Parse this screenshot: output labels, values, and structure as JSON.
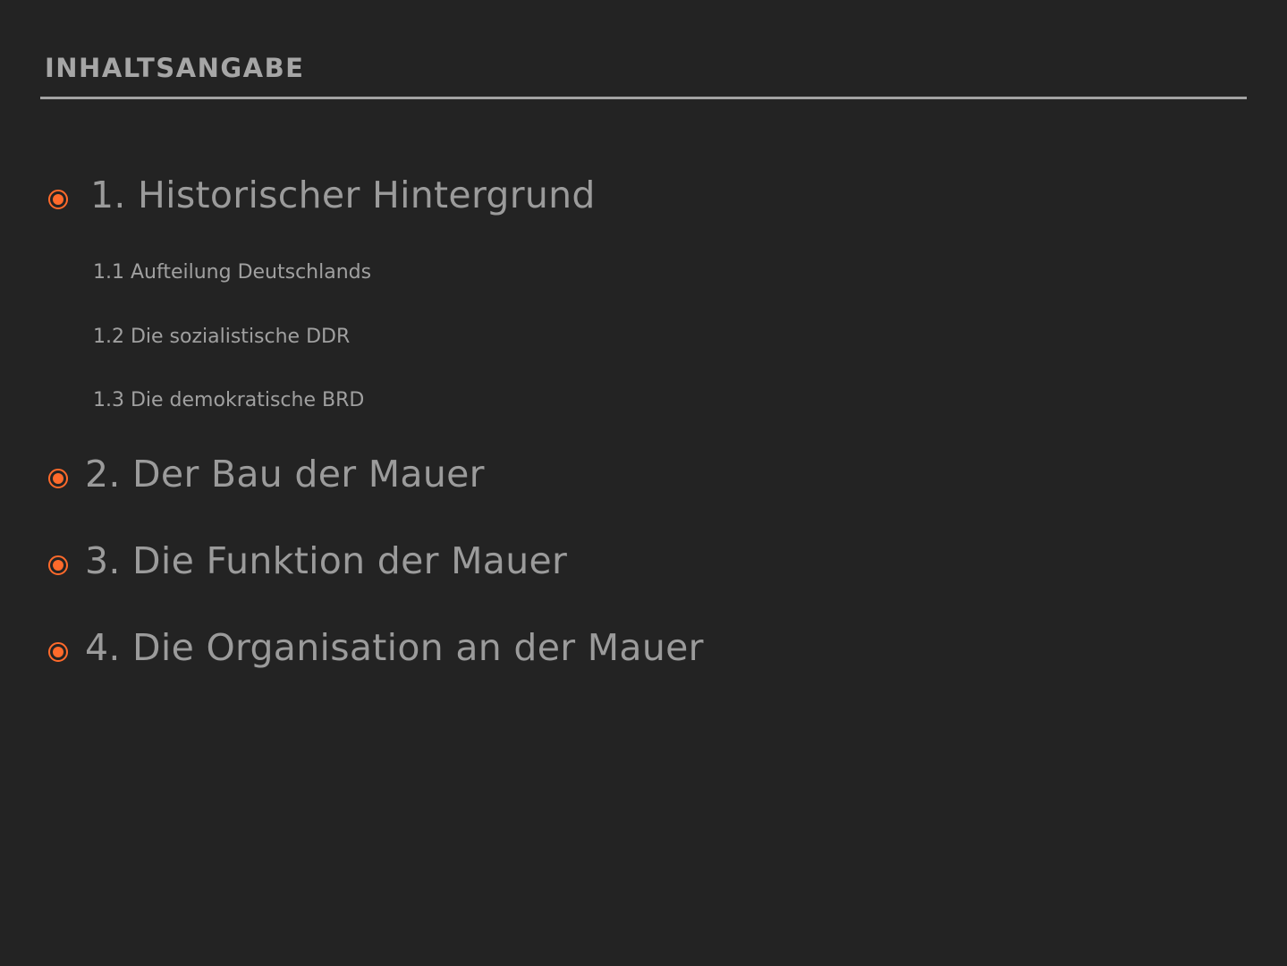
{
  "header": {
    "title": "INHALTSANGABE"
  },
  "accent_color": "#ff6a2b",
  "toc": {
    "items": [
      {
        "label": "1. Historischer Hintergrund",
        "icon": "radio-bullet-icon",
        "subitems": [
          "1.1 Aufteilung Deutschlands",
          "1.2 Die sozialistische DDR",
          "1.3 Die demokratische BRD"
        ]
      },
      {
        "label": "2. Der Bau der Mauer",
        "icon": "radio-bullet-icon"
      },
      {
        "label": "3. Die Funktion der Mauer",
        "icon": "radio-bullet-icon"
      },
      {
        "label": "4. Die Organisation an der Mauer",
        "icon": "radio-bullet-icon"
      }
    ]
  }
}
